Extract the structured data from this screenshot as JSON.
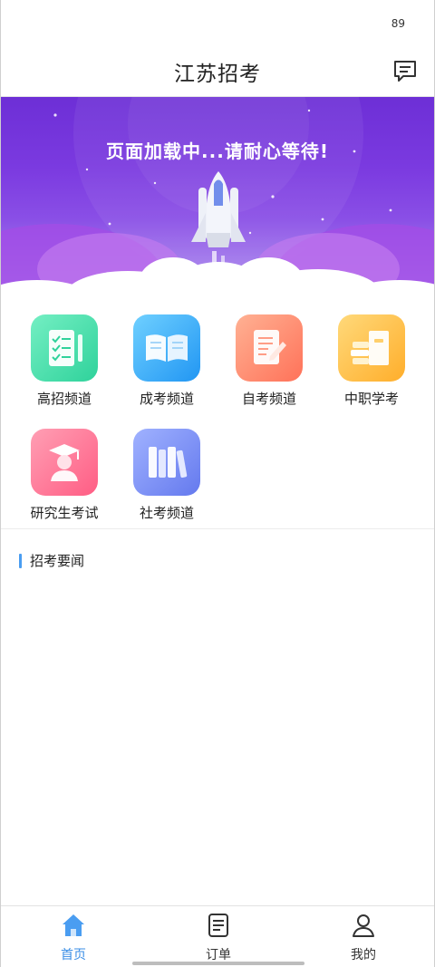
{
  "status_bar": {
    "battery": "89"
  },
  "header": {
    "title": "江苏招考",
    "message_icon": "message-icon"
  },
  "banner": {
    "text": "页面加载中...请耐心等待!"
  },
  "channels": [
    {
      "label": "高招频道",
      "icon": "checklist-icon",
      "color": "#3fd9a4"
    },
    {
      "label": "成考频道",
      "icon": "open-book-icon",
      "color": "#35a4f5"
    },
    {
      "label": "自考频道",
      "icon": "document-pen-icon",
      "color": "#ff8a74"
    },
    {
      "label": "中职学考",
      "icon": "books-stack-icon",
      "color": "#ffbf3c"
    },
    {
      "label": "研究生考试",
      "icon": "graduate-icon",
      "color": "#ff6f91"
    },
    {
      "label": "社考频道",
      "icon": "bookshelf-icon",
      "color": "#6f86f2"
    }
  ],
  "news": {
    "title": "招考要闻"
  },
  "tabbar": {
    "items": [
      {
        "label": "首页",
        "icon": "home-icon",
        "active": true
      },
      {
        "label": "订单",
        "icon": "order-icon",
        "active": false
      },
      {
        "label": "我的",
        "icon": "profile-icon",
        "active": false
      }
    ],
    "accent": "#3a8ee6"
  }
}
